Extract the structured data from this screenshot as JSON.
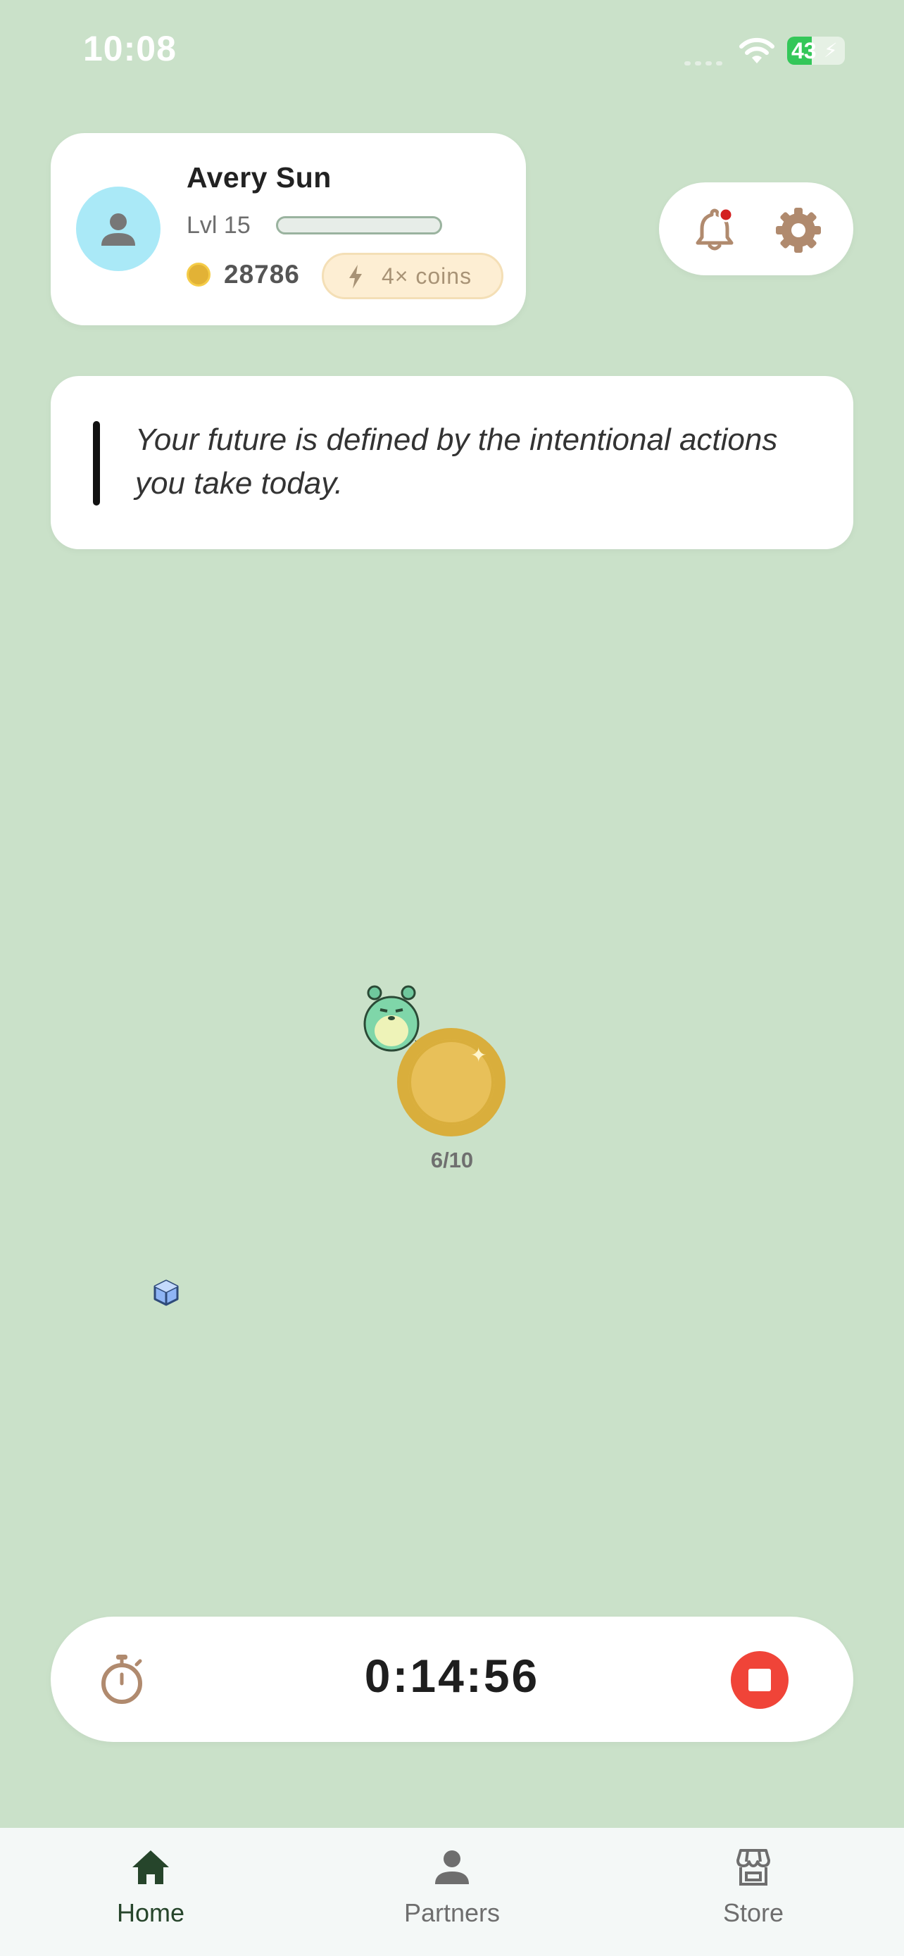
{
  "status_bar": {
    "time": "10:08",
    "battery": "43",
    "battery_level": 0.43
  },
  "profile": {
    "name": "Avery Sun",
    "level": "Lvl 15",
    "xp_progress": 0.0,
    "coins": "28786",
    "boost": "4× coins"
  },
  "quote": "Your future is defined by the intentional actions you take today.",
  "play_area": {
    "coin_progress": "6/10"
  },
  "timer": {
    "value": "0:14:56"
  },
  "tabs": [
    {
      "label": "Home",
      "icon": "home-icon",
      "active": true
    },
    {
      "label": "Partners",
      "icon": "person-icon",
      "active": false
    },
    {
      "label": "Store",
      "icon": "store-icon",
      "active": false
    }
  ],
  "colors": {
    "background": "#cae1c9",
    "stop": "#f04438",
    "accent_brown": "#b08a6e",
    "avatar_bg": "#aae9f7",
    "active_tab": "#26452b"
  }
}
